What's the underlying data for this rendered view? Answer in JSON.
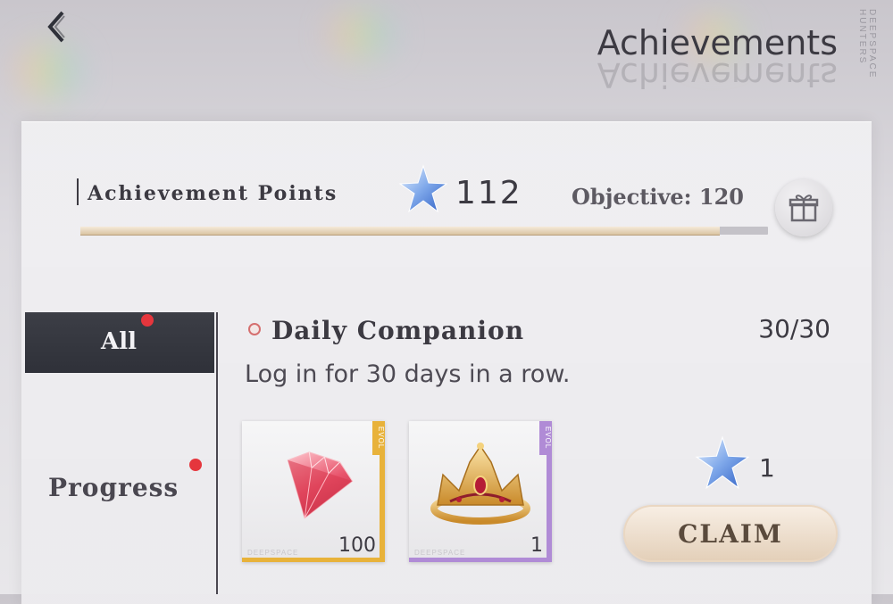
{
  "header": {
    "title": "Achievements",
    "brand": "DEEPSPACE HUNTERS"
  },
  "points": {
    "label": "Achievement Points",
    "value": "112",
    "objective": "Objective: 120",
    "progress_fraction": 0.93
  },
  "sidebar": {
    "tabs": [
      {
        "label": "All",
        "selected": true,
        "has_notification": true
      },
      {
        "label": "Progress",
        "selected": false,
        "has_notification": true
      }
    ]
  },
  "achievement": {
    "title": "Daily Companion",
    "count": "30/30",
    "description": "Log in for 30 days in a row.",
    "rewards": [
      {
        "icon": "diamond-icon",
        "quantity": "100",
        "rarity_color": "#e8b23a",
        "tag": "EVOL",
        "brand": "DEEPSPACE"
      },
      {
        "icon": "crown-icon",
        "quantity": "1",
        "rarity_color": "#b08bd6",
        "tag": "EVOL",
        "brand": "DEEPSPACE"
      }
    ],
    "points_reward": "1",
    "claim_label": "CLAIM"
  },
  "colors": {
    "accent_dark": "#2f3139",
    "notification": "#e5363d",
    "claim_gold": "#e3cfb8"
  }
}
